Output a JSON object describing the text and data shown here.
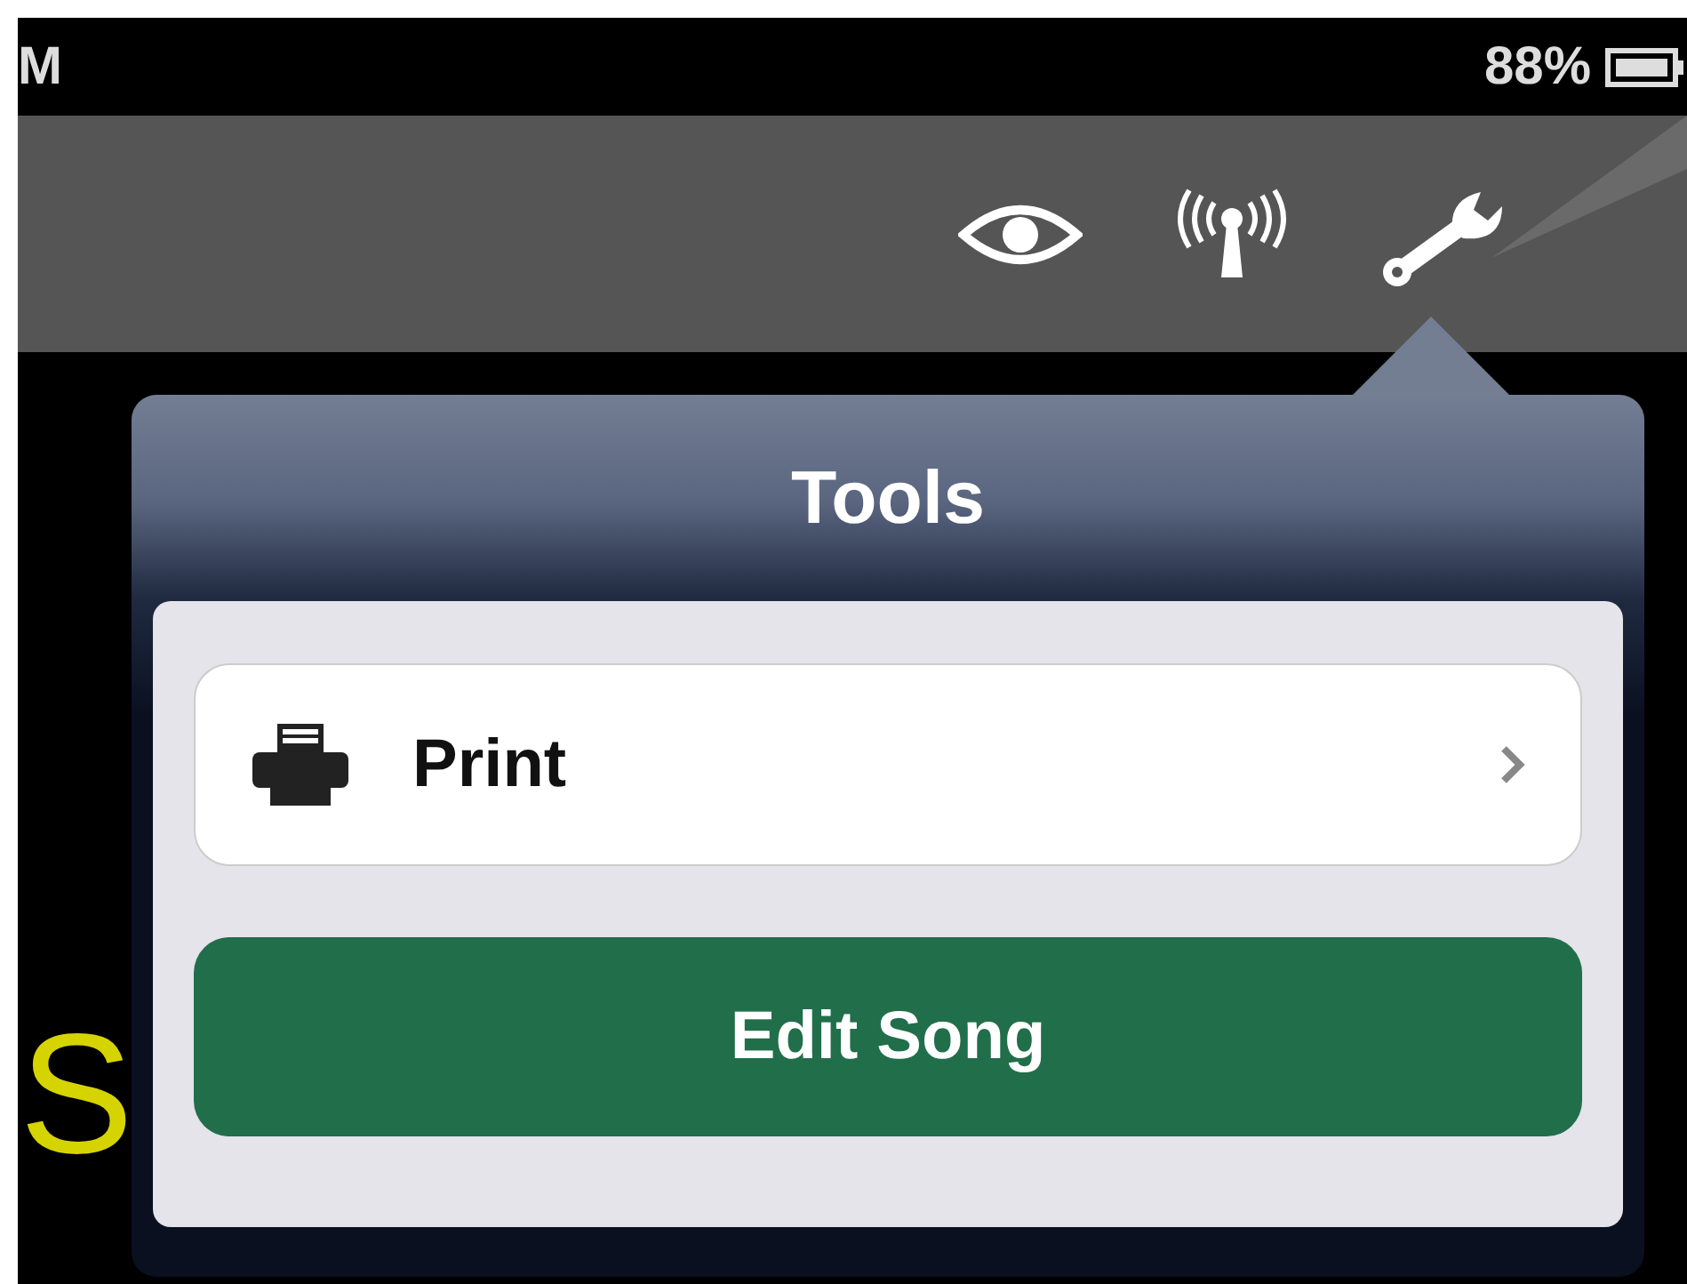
{
  "status_bar": {
    "time": "M",
    "battery": "88%"
  },
  "background_title": "S",
  "popover": {
    "title": "Tools",
    "items": [
      {
        "kind": "row",
        "label": "Print"
      },
      {
        "kind": "button",
        "label": "Edit Song"
      }
    ]
  }
}
